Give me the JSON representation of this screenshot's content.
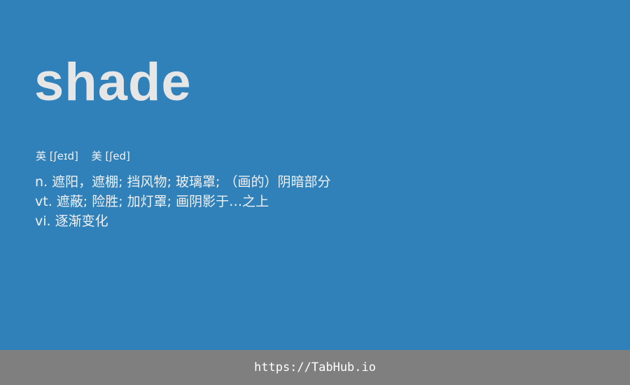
{
  "entry": {
    "word": "shade",
    "phonetics": {
      "uk": "英 [ʃeɪd]",
      "us": "美 [ʃed]"
    },
    "definitions": [
      "n. 遮阳，遮棚; 挡风物; 玻璃罩; （画的）阴暗部分",
      "vt. 遮蔽; 险胜; 加灯罩; 画阴影于…之上",
      "vi. 逐渐变化"
    ]
  },
  "footer": {
    "link": "https://TabHub.io"
  },
  "colors": {
    "background": "#3081ba",
    "footer_background": "#7f7f7f",
    "word": "#e6e6e6",
    "text": "#f1f1f1"
  }
}
